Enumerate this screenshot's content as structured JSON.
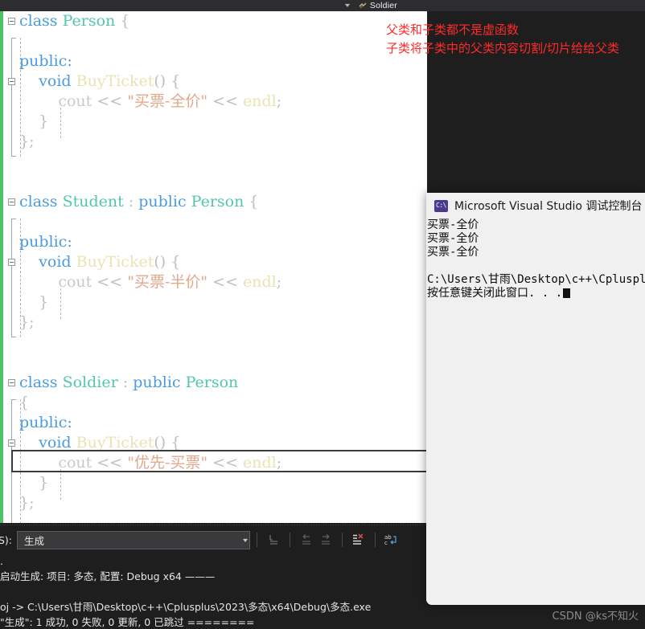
{
  "navbar": {
    "dropdown_icon": "chevron-down-icon",
    "member_icon": "method-icon",
    "member_label": "Soldier"
  },
  "editor": {
    "lines": [
      {
        "indent": 0,
        "glyph": true,
        "segments": [
          {
            "t": "class ",
            "c": "kw"
          },
          {
            "t": "Person",
            "c": "ty"
          },
          {
            "t": " {",
            "c": "pl"
          }
        ]
      },
      {
        "indent": 0,
        "glyph": false,
        "segments": []
      },
      {
        "indent": 0,
        "glyph": false,
        "segments": [
          {
            "t": "public:",
            "c": "kw"
          }
        ]
      },
      {
        "indent": 0,
        "glyph": true,
        "segments": [
          {
            "t": "    ",
            "c": "pl"
          },
          {
            "t": "void ",
            "c": "kw"
          },
          {
            "t": "BuyTicket",
            "c": "fn"
          },
          {
            "t": "() {",
            "c": "pl"
          }
        ]
      },
      {
        "indent": 0,
        "glyph": false,
        "segments": [
          {
            "t": "        ",
            "c": "pl"
          },
          {
            "t": "cout",
            "c": "id"
          },
          {
            "t": " << ",
            "c": "pl"
          },
          {
            "t": "\"买票-全价\"",
            "c": "st"
          },
          {
            "t": " << ",
            "c": "pl"
          },
          {
            "t": "endl",
            "c": "mb"
          },
          {
            "t": ";",
            "c": "pl"
          }
        ]
      },
      {
        "indent": 0,
        "glyph": false,
        "segments": [
          {
            "t": "    }",
            "c": "pl"
          }
        ]
      },
      {
        "indent": 0,
        "glyph": false,
        "segments": [
          {
            "t": "};",
            "c": "pl"
          }
        ]
      },
      {
        "indent": 0,
        "glyph": false,
        "segments": []
      },
      {
        "indent": 0,
        "glyph": false,
        "segments": []
      },
      {
        "indent": 0,
        "glyph": true,
        "segments": [
          {
            "t": "class ",
            "c": "kw"
          },
          {
            "t": "Student",
            "c": "ty"
          },
          {
            "t": " : ",
            "c": "pl"
          },
          {
            "t": "public ",
            "c": "kw"
          },
          {
            "t": "Person",
            "c": "ty"
          },
          {
            "t": " {",
            "c": "pl"
          }
        ]
      },
      {
        "indent": 0,
        "glyph": false,
        "segments": []
      },
      {
        "indent": 0,
        "glyph": false,
        "segments": [
          {
            "t": "public:",
            "c": "kw"
          }
        ]
      },
      {
        "indent": 0,
        "glyph": true,
        "segments": [
          {
            "t": "    ",
            "c": "pl"
          },
          {
            "t": "void ",
            "c": "kw"
          },
          {
            "t": "BuyTicket",
            "c": "fn"
          },
          {
            "t": "() {",
            "c": "pl"
          }
        ]
      },
      {
        "indent": 0,
        "glyph": false,
        "segments": [
          {
            "t": "        ",
            "c": "pl"
          },
          {
            "t": "cout",
            "c": "id"
          },
          {
            "t": " << ",
            "c": "pl"
          },
          {
            "t": "\"买票-半价\"",
            "c": "st"
          },
          {
            "t": " << ",
            "c": "pl"
          },
          {
            "t": "endl",
            "c": "mb"
          },
          {
            "t": ";",
            "c": "pl"
          }
        ]
      },
      {
        "indent": 0,
        "glyph": false,
        "segments": [
          {
            "t": "    }",
            "c": "pl"
          }
        ]
      },
      {
        "indent": 0,
        "glyph": false,
        "segments": [
          {
            "t": "};",
            "c": "pl"
          }
        ]
      },
      {
        "indent": 0,
        "glyph": false,
        "segments": []
      },
      {
        "indent": 0,
        "glyph": false,
        "segments": []
      },
      {
        "indent": 0,
        "glyph": true,
        "segments": [
          {
            "t": "class ",
            "c": "kw"
          },
          {
            "t": "Soldier",
            "c": "ty"
          },
          {
            "t": " : ",
            "c": "pl"
          },
          {
            "t": "public ",
            "c": "kw"
          },
          {
            "t": "Person",
            "c": "ty"
          }
        ]
      },
      {
        "indent": 0,
        "glyph": false,
        "segments": [
          {
            "t": "{",
            "c": "pl"
          }
        ]
      },
      {
        "indent": 0,
        "glyph": false,
        "segments": [
          {
            "t": "public:",
            "c": "kw"
          }
        ]
      },
      {
        "indent": 0,
        "glyph": true,
        "segments": [
          {
            "t": "    ",
            "c": "pl"
          },
          {
            "t": "void ",
            "c": "kw"
          },
          {
            "t": "BuyTicket",
            "c": "fn"
          },
          {
            "t": "() {",
            "c": "pl"
          }
        ]
      },
      {
        "indent": 0,
        "glyph": false,
        "segments": [
          {
            "t": "        ",
            "c": "pl"
          },
          {
            "t": "cout",
            "c": "id"
          },
          {
            "t": " << ",
            "c": "pl"
          },
          {
            "t": "\"优先-买票\"",
            "c": "st"
          },
          {
            "t": " << ",
            "c": "pl"
          },
          {
            "t": "endl",
            "c": "mb"
          },
          {
            "t": ";",
            "c": "pl"
          }
        ]
      },
      {
        "indent": 0,
        "glyph": false,
        "segments": [
          {
            "t": "    }",
            "c": "pl"
          }
        ]
      },
      {
        "indent": 0,
        "glyph": false,
        "segments": [
          {
            "t": "};",
            "c": "pl"
          }
        ]
      }
    ],
    "colors": {
      "keyword": "#4a9be0",
      "type": "#53c6ae",
      "function": "#e8e3b0",
      "string": "#e0a98c",
      "plain": "#bfbfbf",
      "change_bar": "#49c26a"
    }
  },
  "annotation": {
    "color": "#ff2a2a",
    "line1": "父类和子类都不是虚函数",
    "line2": "子类将子类中的父类内容切割/切片给给父类"
  },
  "console": {
    "icon": "console-app-icon",
    "icon_text": "C:\\",
    "title": "Microsoft Visual Studio 调试控制台",
    "lines": [
      "买票-全价",
      "买票-全价",
      "买票-全价",
      "",
      "C:\\Users\\甘雨\\Desktop\\c++\\Cplusplu",
      "按任意键关闭此窗口. . ."
    ]
  },
  "output_pane": {
    "source_label": "S):",
    "source_value": "生成",
    "dropdown_icon": "chevron-down-icon",
    "toolbar_buttons": [
      {
        "name": "go-to-line-icon",
        "enabled": true
      },
      {
        "name": "navigate-back-icon",
        "enabled": false
      },
      {
        "name": "navigate-forward-icon",
        "enabled": false
      },
      {
        "name": "clear-output-icon",
        "enabled": true
      },
      {
        "name": "toggle-word-wrap-icon",
        "enabled": true
      }
    ],
    "lines": [
      ".",
      "启动生成: 项目: 多态, 配置: Debug x64 ———",
      "",
      "oj -> C:\\Users\\甘雨\\Desktop\\c++\\Cplusplus\\2023\\多态\\x64\\Debug\\多态.exe",
      "\"生成\": 1 成功, 0 失败, 0 更新, 0 已跳过 ========"
    ]
  },
  "watermark": "CSDN @ks不知火"
}
